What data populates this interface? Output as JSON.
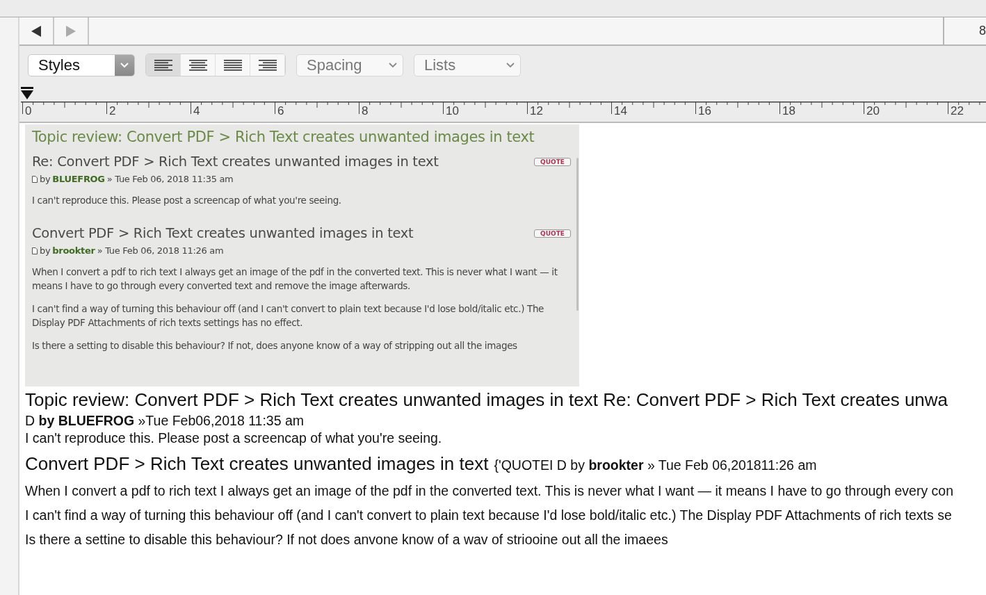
{
  "nav": {
    "back": {
      "disabled": false
    },
    "forward": {
      "disabled": true
    },
    "page_field": "8"
  },
  "toolbar": {
    "styles": "Styles",
    "alignment": [
      {
        "kind": "left",
        "selected": true
      },
      {
        "kind": "center",
        "selected": false
      },
      {
        "kind": "justify",
        "selected": false
      },
      {
        "kind": "right",
        "selected": false
      }
    ],
    "spacing": "Spacing",
    "lists": "Lists"
  },
  "ruler": {
    "labels": [
      "0",
      "2",
      "4",
      "6",
      "8",
      "10",
      "12",
      "14",
      "16",
      "18",
      "20",
      "22"
    ]
  },
  "embedded_screenshot": {
    "topic_title": "Topic review: Convert PDF > Rich Text creates unwanted images in text",
    "posts": [
      {
        "title": "Re: Convert PDF > Rich Text creates unwanted images in text",
        "quote_button": "QUOTE",
        "by": "by",
        "author": "BLUEFROG",
        "date": "» Tue Feb 06, 2018 11:35 am",
        "paragraphs": [
          "I can't reproduce this. Please post a screencap of what you're seeing."
        ]
      },
      {
        "title": "Convert PDF > Rich Text creates unwanted images in text",
        "quote_button": "QUOTE",
        "by": "by",
        "author": "brookter",
        "date": "» Tue Feb 06, 2018 11:26 am",
        "paragraphs": [
          "When I convert a pdf to rich text I always get an image of the pdf in the converted text. This is never what I want — it means I have to go through every converted text and remove the image afterwards.",
          "I can't find a way of turning this behaviour off (and I can't convert to plain text because I'd lose bold/italic etc.) The Display PDF Attachments of rich texts settings has no effect.",
          "Is there a setting to disable this behaviour? If not, does anyone know of a way of stripping out all the images"
        ]
      }
    ]
  },
  "ocr_text": [
    {
      "kind": "heading",
      "text": "Topic review: Convert PDF > Rich Text creates unwanted images in text Re: Convert PDF > Rich Text creates unwa"
    },
    {
      "kind": "meta",
      "text": "D **by BLUEFROG** »Tue Feb06,2018 11:35 am"
    },
    {
      "kind": "body",
      "text": "I can't reproduce this. Please post a screencap of what you're seeing."
    },
    {
      "kind": "heading_meta",
      "text": "Convert PDF > Rich Text creates unwanted images in text",
      "meta": "{'QUOTEI D by **brookter** » Tue Feb 06,201811:26 am"
    },
    {
      "kind": "para",
      "text": "When I convert a pdf to rich text I always get an image of the pdf in the converted text. This is never what I want — it means I have to go through every con"
    },
    {
      "kind": "para",
      "text": "I can't find a way of turning this behaviour off (and I can't convert to plain text because I'd lose bold/italic etc.) The Display PDF Attachments of rich texts se"
    },
    {
      "kind": "para",
      "text": "Is there a settine to disable this behaviour? If not does anvone know of a wav of striooine out all the imaees"
    }
  ]
}
